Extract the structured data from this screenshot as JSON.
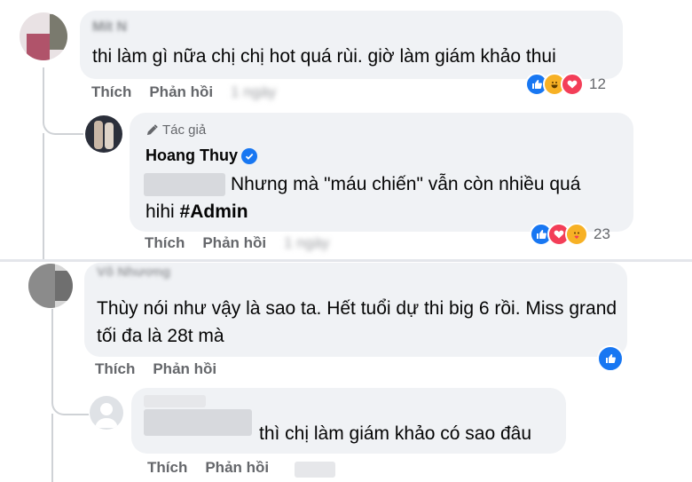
{
  "comments": [
    {
      "author": "Mít N",
      "text": "thi làm gì nữa chị chị hot quá rùi. giờ làm giám khảo thui",
      "like_label": "Thích",
      "reply_label": "Phản hồi",
      "time": "1 ngày",
      "reaction_count": "12",
      "reactions": [
        "like-icon",
        "haha-icon",
        "love-icon"
      ]
    },
    {
      "author_badge": "Tác giả",
      "author": "Hoang Thuy",
      "text_line1": "Nhưng mà \"máu chiến\" vẫn còn nhiều quá",
      "text_line2_prefix": "hihi ",
      "hashtag": "#Admin",
      "like_label": "Thích",
      "reply_label": "Phản hồi",
      "time": "1 ngày",
      "reaction_count": "23",
      "reactions": [
        "like-icon",
        "love-icon",
        "care-icon"
      ]
    },
    {
      "author": "Võ Nhương",
      "text": "Thùy nói như vậy là sao ta. Hết tuổi dự thi big 6 rồi. Miss grand tối đa là 28t mà",
      "like_label": "Thích",
      "reply_label": "Phản hồi",
      "reactions": [
        "like-icon"
      ]
    },
    {
      "text": "thì chị làm giám khảo có sao đâu",
      "like_label": "Thích",
      "reply_label": "Phản hồi"
    }
  ],
  "colors": {
    "bubble": "#f0f2f5",
    "muted": "#65676b",
    "like": "#1877f2",
    "love": "#f33e58",
    "haha": "#f7b125"
  }
}
